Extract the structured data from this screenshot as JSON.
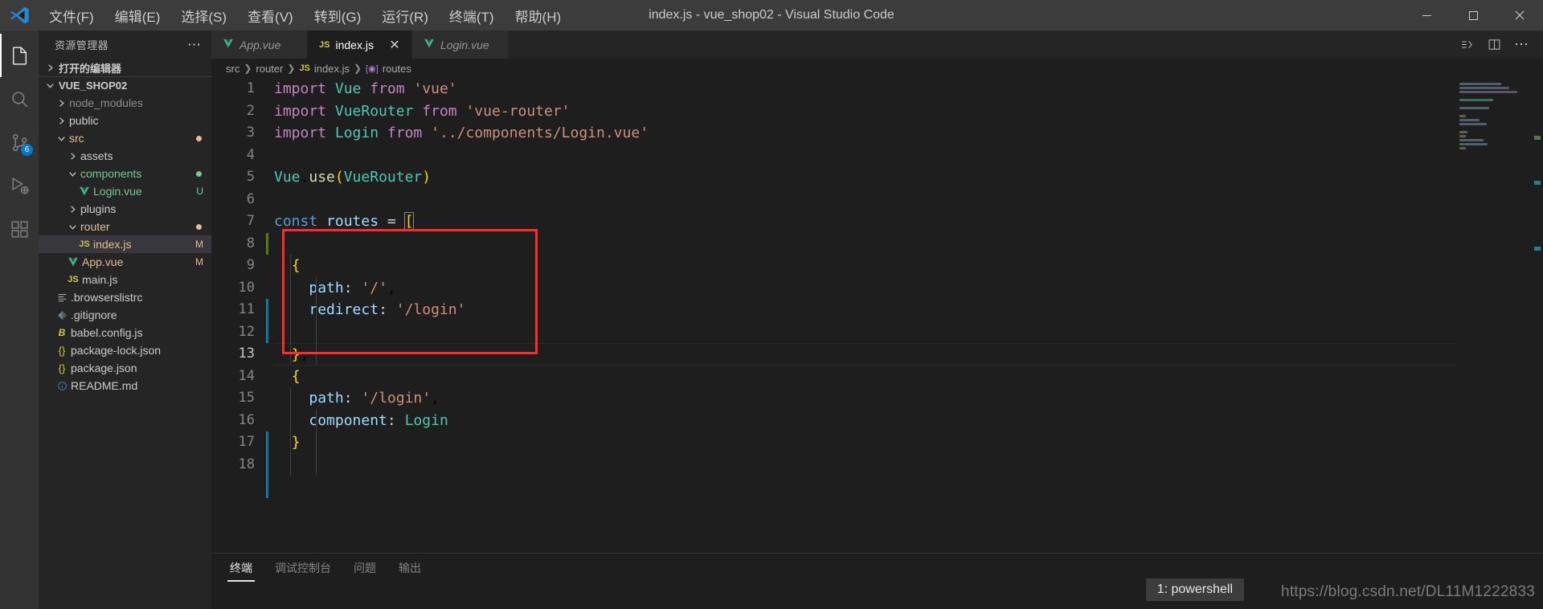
{
  "window": {
    "title": "index.js - vue_shop02 - Visual Studio Code",
    "logo_icon": "vscode-logo-icon",
    "minimize_icon": "minimize-icon",
    "maximize_icon": "maximize-icon",
    "close_icon": "close-icon"
  },
  "menubar": {
    "items": [
      {
        "label": "文件(F)",
        "name": "menu-file"
      },
      {
        "label": "编辑(E)",
        "name": "menu-edit"
      },
      {
        "label": "选择(S)",
        "name": "menu-selection"
      },
      {
        "label": "查看(V)",
        "name": "menu-view"
      },
      {
        "label": "转到(G)",
        "name": "menu-go"
      },
      {
        "label": "运行(R)",
        "name": "menu-run"
      },
      {
        "label": "终端(T)",
        "name": "menu-terminal"
      },
      {
        "label": "帮助(H)",
        "name": "menu-help"
      }
    ]
  },
  "activitybar": {
    "items": [
      {
        "name": "explorer-icon",
        "active": true,
        "badge": ""
      },
      {
        "name": "search-icon",
        "active": false,
        "badge": ""
      },
      {
        "name": "source-control-icon",
        "active": false,
        "badge": "6"
      },
      {
        "name": "run-debug-icon",
        "active": false,
        "badge": ""
      },
      {
        "name": "extensions-icon",
        "active": false,
        "badge": ""
      }
    ]
  },
  "sidebar": {
    "header_title": "资源管理器",
    "header_more_icon": "more-actions-icon",
    "open_editors_label": "打开的编辑器",
    "project_label": "VUE_SHOP02",
    "tree": [
      {
        "label": "node_modules",
        "indent": 1,
        "type": "folder",
        "expanded": false,
        "color": "#8b8b8b",
        "badge": "",
        "badge_color": "",
        "icon": "folder-icon",
        "name": "tree-item-node-modules"
      },
      {
        "label": "public",
        "indent": 1,
        "type": "folder",
        "expanded": false,
        "color": "#cccccc",
        "badge": "",
        "badge_color": "",
        "icon": "folder-icon",
        "name": "tree-item-public"
      },
      {
        "label": "src",
        "indent": 1,
        "type": "folder",
        "expanded": true,
        "color": "#e2c08d",
        "badge": "dot",
        "badge_color": "#e2c08d",
        "icon": "folder-open-icon",
        "name": "tree-item-src"
      },
      {
        "label": "assets",
        "indent": 2,
        "type": "folder",
        "expanded": false,
        "color": "#cccccc",
        "badge": "",
        "badge_color": "",
        "icon": "folder-icon",
        "name": "tree-item-assets"
      },
      {
        "label": "components",
        "indent": 2,
        "type": "folder",
        "expanded": true,
        "color": "#73c991",
        "badge": "dot",
        "badge_color": "#73c991",
        "icon": "folder-open-icon",
        "name": "tree-item-components"
      },
      {
        "label": "Login.vue",
        "indent": 3,
        "type": "file",
        "expanded": false,
        "color": "#73c991",
        "badge": "U",
        "badge_color": "#73c991",
        "icon": "vue-file-icon",
        "name": "tree-item-login-vue"
      },
      {
        "label": "plugins",
        "indent": 2,
        "type": "folder",
        "expanded": false,
        "color": "#cccccc",
        "badge": "",
        "badge_color": "",
        "icon": "folder-icon",
        "name": "tree-item-plugins"
      },
      {
        "label": "router",
        "indent": 2,
        "type": "folder",
        "expanded": true,
        "color": "#e2c08d",
        "badge": "dot",
        "badge_color": "#e2c08d",
        "icon": "folder-open-icon",
        "name": "tree-item-router"
      },
      {
        "label": "index.js",
        "indent": 3,
        "type": "file",
        "expanded": false,
        "color": "#e2c08d",
        "badge": "M",
        "badge_color": "#e2c08d",
        "icon": "js-file-icon",
        "selected": true,
        "name": "tree-item-index-js"
      },
      {
        "label": "App.vue",
        "indent": 2,
        "type": "file",
        "expanded": false,
        "color": "#e2c08d",
        "badge": "M",
        "badge_color": "#e2c08d",
        "icon": "vue-file-icon",
        "name": "tree-item-app-vue"
      },
      {
        "label": "main.js",
        "indent": 2,
        "type": "file",
        "expanded": false,
        "color": "#cccccc",
        "badge": "",
        "badge_color": "",
        "icon": "js-file-icon",
        "name": "tree-item-main-js"
      },
      {
        "label": ".browserslistrc",
        "indent": 1,
        "type": "file",
        "expanded": false,
        "color": "#cccccc",
        "badge": "",
        "badge_color": "",
        "icon": "config-file-icon",
        "name": "tree-item-browserslistrc"
      },
      {
        "label": ".gitignore",
        "indent": 1,
        "type": "file",
        "expanded": false,
        "color": "#cccccc",
        "badge": "",
        "badge_color": "",
        "icon": "git-file-icon",
        "name": "tree-item-gitignore"
      },
      {
        "label": "babel.config.js",
        "indent": 1,
        "type": "file",
        "expanded": false,
        "color": "#cccccc",
        "badge": "",
        "badge_color": "",
        "icon": "babel-file-icon",
        "name": "tree-item-babel-config"
      },
      {
        "label": "package-lock.json",
        "indent": 1,
        "type": "file",
        "expanded": false,
        "color": "#cccccc",
        "badge": "",
        "badge_color": "",
        "icon": "json-file-icon",
        "name": "tree-item-package-lock"
      },
      {
        "label": "package.json",
        "indent": 1,
        "type": "file",
        "expanded": false,
        "color": "#cccccc",
        "badge": "",
        "badge_color": "",
        "icon": "json-file-icon",
        "name": "tree-item-package-json"
      },
      {
        "label": "README.md",
        "indent": 1,
        "type": "file",
        "expanded": false,
        "color": "#cccccc",
        "badge": "",
        "badge_color": "",
        "icon": "markdown-file-icon",
        "name": "tree-item-readme"
      }
    ]
  },
  "tabs": [
    {
      "label": "App.vue",
      "icon": "vue-file-icon",
      "active": false,
      "dirty": false,
      "italic": true,
      "name": "tab-app-vue"
    },
    {
      "label": "index.js",
      "icon": "js-file-icon",
      "active": true,
      "dirty": false,
      "italic": false,
      "name": "tab-index-js"
    },
    {
      "label": "Login.vue",
      "icon": "vue-file-icon",
      "active": false,
      "dirty": false,
      "italic": true,
      "name": "tab-login-vue"
    }
  ],
  "editor_actions": [
    {
      "name": "split-editor-vertical-icon"
    },
    {
      "name": "split-editor-icon"
    },
    {
      "name": "more-actions-icon"
    }
  ],
  "breadcrumb": {
    "items": [
      {
        "label": "src",
        "icon": "",
        "name": "breadcrumb-src"
      },
      {
        "label": "router",
        "icon": "",
        "name": "breadcrumb-router"
      },
      {
        "label": "index.js",
        "icon": "js-file-icon",
        "name": "breadcrumb-index-js"
      },
      {
        "label": "routes",
        "icon": "symbol-variable-icon",
        "name": "breadcrumb-routes"
      }
    ]
  },
  "editor": {
    "filename": "index.js",
    "language": "javascript",
    "first_line": 1,
    "cursor_line": 13,
    "lines": [
      {
        "n": 1,
        "text": "import Vue from 'vue'"
      },
      {
        "n": 2,
        "text": "import VueRouter from 'vue-router'"
      },
      {
        "n": 3,
        "text": "import Login from '../components/Login.vue'"
      },
      {
        "n": 4,
        "text": ""
      },
      {
        "n": 5,
        "text": "Vue.use(VueRouter)"
      },
      {
        "n": 6,
        "text": ""
      },
      {
        "n": 7,
        "text": "const routes = ["
      },
      {
        "n": 8,
        "text": ""
      },
      {
        "n": 9,
        "text": "  {"
      },
      {
        "n": 10,
        "text": "    path: '/',"
      },
      {
        "n": 11,
        "text": "    redirect: '/login'"
      },
      {
        "n": 12,
        "text": ""
      },
      {
        "n": 13,
        "text": "  },"
      },
      {
        "n": 14,
        "text": "  {"
      },
      {
        "n": 15,
        "text": "    path: '/login',"
      },
      {
        "n": 16,
        "text": "    component: Login"
      },
      {
        "n": 17,
        "text": "  }"
      },
      {
        "n": 18,
        "text": ""
      }
    ]
  },
  "annotation": {
    "name": "red-highlight-box",
    "color": "#ff2a2a",
    "covers_lines": "8-13"
  },
  "panel": {
    "tabs": [
      {
        "label": "终端",
        "active": true,
        "name": "panel-tab-terminal"
      },
      {
        "label": "调试控制台",
        "active": false,
        "name": "panel-tab-debug-console"
      },
      {
        "label": "问题",
        "active": false,
        "name": "panel-tab-problems"
      },
      {
        "label": "输出",
        "active": false,
        "name": "panel-tab-output"
      }
    ],
    "terminal_selector": "1: powershell"
  },
  "watermark": "https://blog.csdn.net/DL11M1222833",
  "colors": {
    "accent": "#007acc",
    "titlebar_bg": "#3c3c3c",
    "sidebar_bg": "#252526",
    "editor_bg": "#1e1e1e",
    "annotation_red": "#ff2a2a"
  }
}
